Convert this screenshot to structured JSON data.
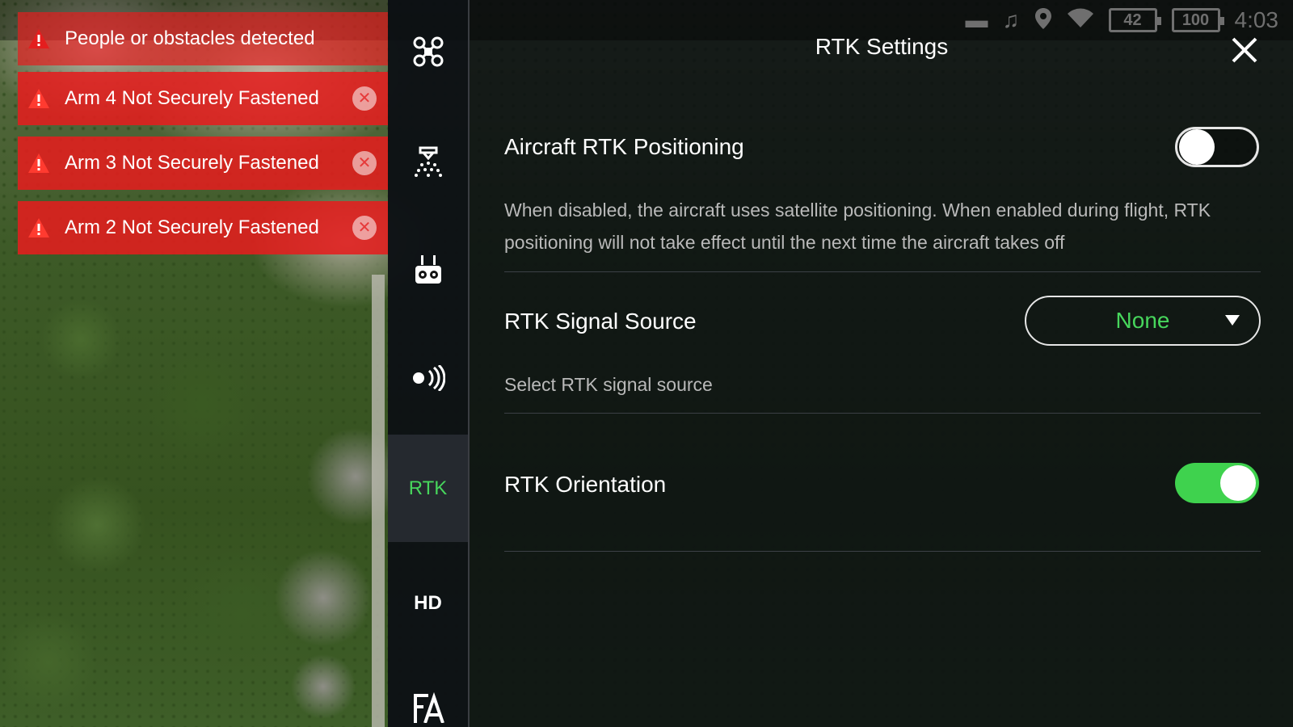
{
  "status_bar": {
    "battery_left": "42",
    "battery_right": "100",
    "time": "4:03",
    "icons": [
      "remote-controller-icon",
      "music-off-icon",
      "location-icon",
      "wifi-icon"
    ]
  },
  "alerts": [
    {
      "text": "People or obstacles detected",
      "closable": false
    },
    {
      "text": "Arm 4 Not Securely Fastened",
      "closable": true
    },
    {
      "text": "Arm 3 Not Securely Fastened",
      "closable": true
    },
    {
      "text": "Arm 2 Not Securely Fastened",
      "closable": true
    }
  ],
  "nav": {
    "items": [
      {
        "icon": "aircraft-icon",
        "label": ""
      },
      {
        "icon": "spray-icon",
        "label": ""
      },
      {
        "icon": "remote-controller-icon",
        "label": ""
      },
      {
        "icon": "signal-icon",
        "label": ""
      },
      {
        "icon": "rtk-icon",
        "label": "RTK",
        "active": true
      },
      {
        "icon": "hd-icon",
        "label": "HD"
      },
      {
        "icon": "general-settings-icon",
        "label": ""
      }
    ]
  },
  "panel": {
    "title": "RTK Settings",
    "aircraft_rtk": {
      "title": "Aircraft RTK Positioning",
      "enabled": false,
      "description": "When disabled, the aircraft uses satellite positioning. When enabled during flight, RTK positioning will not take effect until the next time the aircraft takes off"
    },
    "signal_source": {
      "title": "RTK Signal Source",
      "value": "None",
      "description": "Select RTK signal source"
    },
    "orientation": {
      "title": "RTK Orientation",
      "enabled": true
    }
  },
  "colors": {
    "accent_green": "#47d65c",
    "toggle_on": "#3fd24e",
    "alert_red": "#e41e1e"
  }
}
